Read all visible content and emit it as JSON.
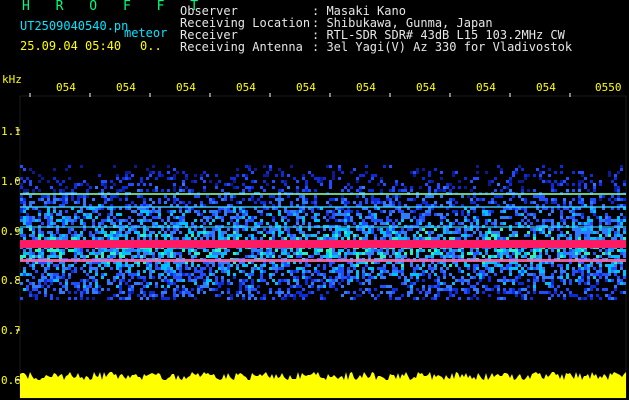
{
  "header": {
    "brand": "H R O F F T",
    "filename": "UT2509040540.pn",
    "suffix": "meteor",
    "date_time": "25.09.04 05:40",
    "count": "0..",
    "labels": [
      "Observer",
      "Receiving Location",
      "Receiver",
      "Receiving Antenna"
    ],
    "values": [
      ": Masaki Kano",
      ": Shibukawa, Gunma, Japan",
      ": RTL-SDR SDR# 43dB L15 103.2MHz CW",
      ": 3el Yagi(V) Az 330 for Vladivostok"
    ]
  },
  "axis": {
    "unit": "kHz",
    "time_ticks": [
      "054",
      "054",
      "054",
      "054",
      "054",
      "054",
      "054",
      "054",
      "054",
      "0550"
    ],
    "freq_ticks": [
      "1.1",
      "1.0",
      "0.9",
      "0.8",
      "0.7",
      "0.6"
    ]
  },
  "colors": {
    "background": "#000000",
    "text_yellow": "#ffff00",
    "text_cyan": "#00e5ff",
    "brand_green": "#00ff7f",
    "noise_blue": "#0a2bd6",
    "signal_red": "#ff1a66",
    "level_bar": "#ffff00"
  }
}
